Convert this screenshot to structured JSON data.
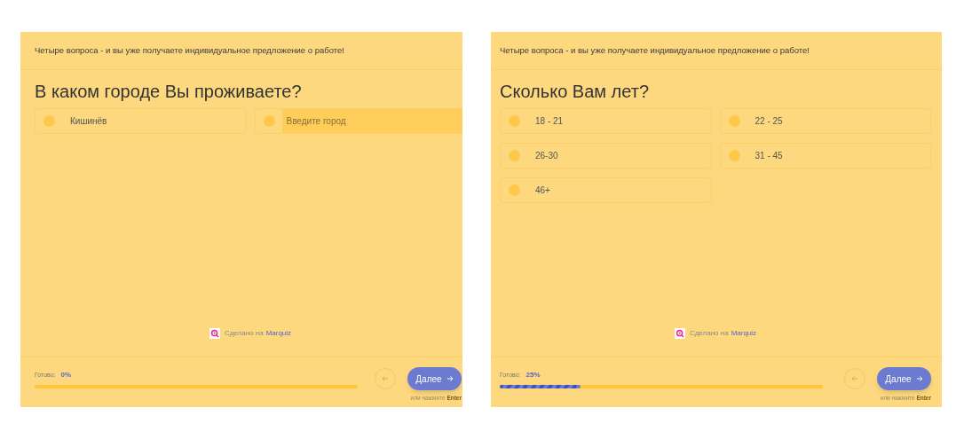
{
  "panels": [
    {
      "header": "Четыре вопроса - и вы уже получаете индивидуальное предложение о работе!",
      "question": "В каком городе Вы проживаете?",
      "options": [
        {
          "kind": "radio",
          "label": "Кишинёв",
          "selected": false
        },
        {
          "kind": "input",
          "placeholder": "Введите город",
          "selected": false
        }
      ],
      "credit": {
        "text": "Сделано на",
        "link": "Marquiz"
      },
      "progress": {
        "label": "Готово:",
        "percent": "0%",
        "level": 0
      },
      "next_button": "Далее",
      "hint": {
        "text": "или нажмите",
        "key": "Enter"
      }
    },
    {
      "header": "Четыре вопроса - и вы уже получаете индивидуальное предложение о работе!",
      "question": "Сколько Вам лет?",
      "options": [
        {
          "kind": "radio",
          "label": "18 - 21",
          "selected": false
        },
        {
          "kind": "radio",
          "label": "22 - 25",
          "selected": false
        },
        {
          "kind": "radio",
          "label": "26-30",
          "selected": false
        },
        {
          "kind": "radio",
          "label": "31 - 45",
          "selected": false
        },
        {
          "kind": "radio",
          "label": "46+",
          "selected": false
        }
      ],
      "credit": {
        "text": "Сделано на",
        "link": "Marquiz"
      },
      "progress": {
        "label": "Готово:",
        "percent": "25%",
        "level": 0.25
      },
      "next_button": "Далее",
      "hint": {
        "text": "или нажмите",
        "key": "Enter"
      }
    }
  ]
}
